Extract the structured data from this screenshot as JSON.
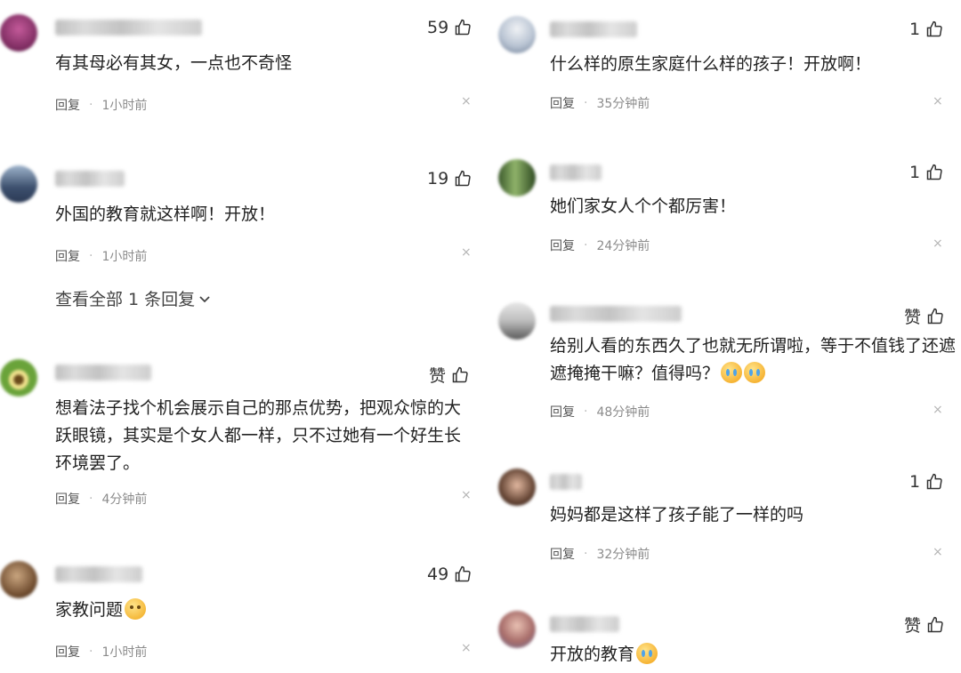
{
  "reply_label": "回复",
  "close_glyph": "×",
  "like_icon": "thumbs-up-icon",
  "left": [
    {
      "likes": "59",
      "text_lines": [
        "有其母必有其女，一点也不奇怪"
      ],
      "time": "1小时前"
    },
    {
      "likes": "19",
      "text_lines": [
        "外国的教育就这样啊！开放！"
      ],
      "time": "1小时前",
      "more_replies": "查看全部 1 条回复"
    },
    {
      "likes": "赞",
      "text_lines": [
        "想着法子找个机会展示自己的那点优势，把观众惊的大",
        "跃眼镜，其实是个女人都一样，只不过她有一个好生长",
        "环境罢了。"
      ],
      "time": "4分钟前"
    },
    {
      "likes": "49",
      "text_lines": [
        "家教问题"
      ],
      "time": "1小时前"
    }
  ],
  "right": [
    {
      "likes": "1",
      "text_lines": [
        "什么样的原生家庭什么样的孩子！开放啊！"
      ],
      "time": "35分钟前"
    },
    {
      "likes": "1",
      "text_lines": [
        "她们家女人个个都厉害！"
      ],
      "time": "24分钟前"
    },
    {
      "likes": "赞",
      "text_lines": [
        "给别人看的东西久了也就无所谓啦，等于不值钱了还遮",
        "遮掩掩干嘛？值得吗？"
      ],
      "time": "48分钟前"
    },
    {
      "likes": "1",
      "text_lines": [
        "妈妈都是这样了孩子能了一样的吗"
      ],
      "time": "32分钟前"
    },
    {
      "likes": "赞",
      "text_lines": [
        "开放的教育"
      ],
      "time": ""
    }
  ]
}
